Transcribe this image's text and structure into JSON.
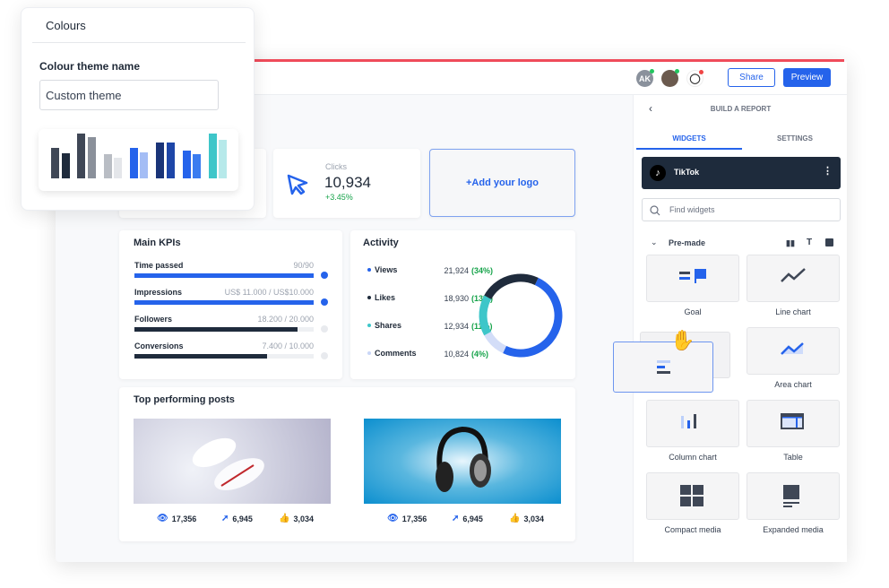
{
  "colours_popup": {
    "title": "Colours",
    "field_label": "Colour theme name",
    "field_value": "Custom theme",
    "palette_bars": [
      {
        "color": "#3f4756",
        "level": 0.68
      },
      {
        "color": "#1f2b3c",
        "level": 0.56
      },
      {
        "color": "#3f4756",
        "level": 1.0
      },
      {
        "color": "#8a909a",
        "level": 0.92
      },
      {
        "color": "#b9bdc4",
        "level": 0.54
      },
      {
        "color": "#e4e6ea",
        "level": 0.46
      },
      {
        "color": "#2563eb",
        "level": 0.68
      },
      {
        "color": "#a4bdf5",
        "level": 0.58
      },
      {
        "color": "#1a3478",
        "level": 0.8
      },
      {
        "color": "#1e46a8",
        "level": 0.8
      },
      {
        "color": "#2563eb",
        "level": 0.62
      },
      {
        "color": "#3b7cf0",
        "level": 0.54
      },
      {
        "color": "#3ec6c9",
        "level": 1.0
      },
      {
        "color": "#b6e9ea",
        "level": 0.86
      }
    ]
  },
  "header": {
    "avatar_initials": "AK",
    "share_label": "Share",
    "preview_label": "Preview"
  },
  "clicks": {
    "label": "Clicks",
    "value": "10,934",
    "change": "+3.45%"
  },
  "logo_label": "+Add your logo",
  "kpis": {
    "title": "Main KPIs",
    "items": [
      {
        "label": "Time passed",
        "value": "90/90",
        "progress": 1.0,
        "color": "#2563eb",
        "done": true
      },
      {
        "label": "Impressions",
        "value": "US$ 11.000 / US$10.000",
        "progress": 1.0,
        "color": "#2563eb",
        "done": true
      },
      {
        "label": "Followers",
        "value": "18.200 / 20.000",
        "progress": 0.91,
        "color": "#1f2b3c",
        "done": false
      },
      {
        "label": "Conversions",
        "value": "7.400 / 10.000",
        "progress": 0.74,
        "color": "#1f2b3c",
        "done": false
      }
    ]
  },
  "activity": {
    "title": "Activity",
    "items": [
      {
        "label": "Views",
        "value": "21,924",
        "pct": "(34%)",
        "color": "#2563eb"
      },
      {
        "label": "Likes",
        "value": "18,930",
        "pct": "(13%)",
        "color": "#1f2b3c"
      },
      {
        "label": "Shares",
        "value": "12,934",
        "pct": "(11%)",
        "color": "#3ec6c9"
      },
      {
        "label": "Comments",
        "value": "10,824",
        "pct": "(4%)",
        "color": "#c9d6f7"
      }
    ],
    "donut_order": [
      {
        "color": "#2563eb",
        "share": 0.5
      },
      {
        "color": "#d3ddf8",
        "share": 0.1
      },
      {
        "color": "#3ec6c9",
        "share": 0.16
      },
      {
        "color": "#1f2b3c",
        "share": 0.24
      }
    ]
  },
  "posts": {
    "title": "Top performing posts",
    "items": [
      {
        "views": "17,356",
        "shares": "6,945",
        "likes": "3,034"
      },
      {
        "views": "17,356",
        "shares": "6,945",
        "likes": "3,034"
      }
    ]
  },
  "panel": {
    "title": "BUILD A REPORT",
    "tabs": [
      "WIDGETS",
      "SETTINGS"
    ],
    "source": "TikTok",
    "search_placeholder": "Find widgets",
    "section": "Pre-made",
    "widgets": [
      "Goal",
      "Line chart",
      "",
      "Area chart",
      "Column chart",
      "Table",
      "Compact media",
      "Expanded media"
    ]
  },
  "colors": {
    "accent": "#2563eb",
    "dark": "#1e2b3c",
    "positive": "#16a34a"
  }
}
